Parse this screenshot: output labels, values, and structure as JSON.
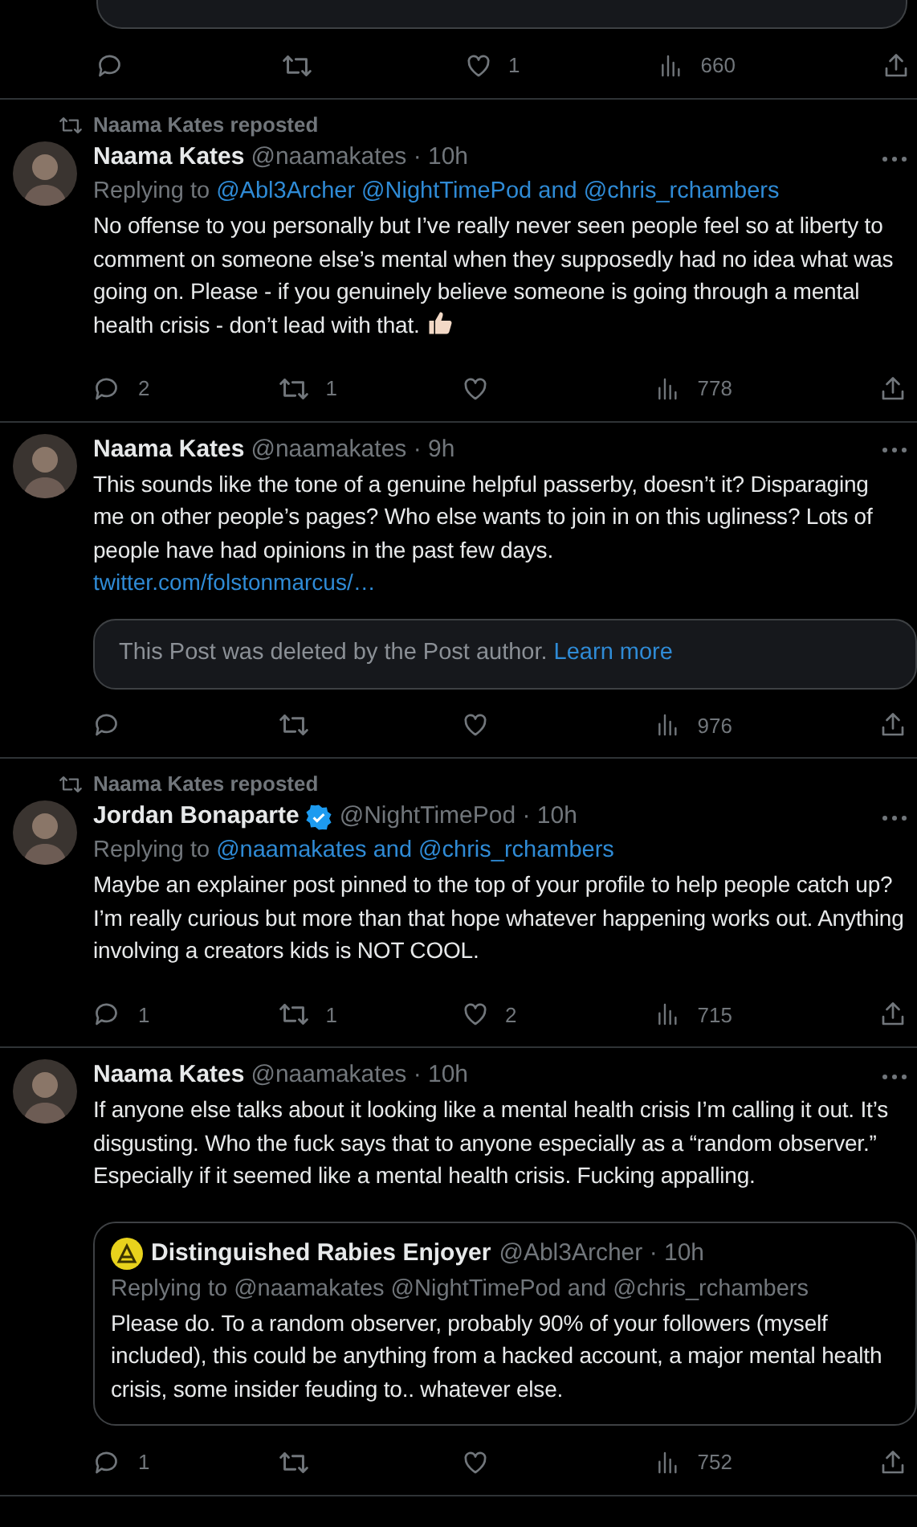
{
  "top_actions": [
    {
      "kind": "reply"
    },
    {
      "kind": "repost"
    },
    {
      "kind": "like",
      "count": "1"
    },
    {
      "kind": "views",
      "count": "660"
    },
    {
      "kind": "share"
    }
  ],
  "posts": [
    {
      "reposted_by": "Naama Kates reposted",
      "name": "Naama Kates",
      "verified": false,
      "meta": "@naamakates · 10h",
      "reply_prefix": "Replying to",
      "reply_to": "@Abl3Archer @NightTimePod and @chris_rchambers",
      "text": "No offense to you personally but I’ve really never seen people feel so at liberty to comment on someone else’s mental when they supposedly had no idea what was going on. Please - if you genuinely believe someone is going through a mental health crisis - don’t lead with that.",
      "ends_with_emoji": true,
      "actions": [
        {
          "kind": "reply",
          "count": "2"
        },
        {
          "kind": "repost",
          "count": "1"
        },
        {
          "kind": "like"
        },
        {
          "kind": "views",
          "count": "778"
        },
        {
          "kind": "share"
        }
      ]
    },
    {
      "name": "Naama Kates",
      "verified": false,
      "meta": "@naamakates · 9h",
      "text": "This sounds like the tone of a genuine helpful passerby, doesn’t it? Disparaging me on other people’s pages? Who else wants to join in on this ugliness? Lots of people have had opinions in the past few days.",
      "link": "twitter.com/folstonmarcus/…",
      "deleted_notice": {
        "text": "This Post was deleted by the Post author.",
        "link": "Learn more"
      },
      "actions": [
        {
          "kind": "reply"
        },
        {
          "kind": "repost"
        },
        {
          "kind": "like"
        },
        {
          "kind": "views",
          "count": "976"
        },
        {
          "kind": "share"
        }
      ]
    },
    {
      "reposted_by": "Naama Kates reposted",
      "name": "Jordan Bonaparte",
      "verified": true,
      "meta": "@NightTimePod · 10h",
      "reply_prefix": "Replying to",
      "reply_to": "@naamakates and @chris_rchambers",
      "text": "Maybe an explainer post pinned to the top of your profile to help people catch up? I’m really curious but more than that hope whatever happening works out. Anything involving a creators kids is NOT COOL.",
      "actions": [
        {
          "kind": "reply",
          "count": "1"
        },
        {
          "kind": "repost",
          "count": "1"
        },
        {
          "kind": "like",
          "count": "2"
        },
        {
          "kind": "views",
          "count": "715"
        },
        {
          "kind": "share"
        }
      ]
    },
    {
      "name": "Naama Kates",
      "verified": false,
      "meta": "@naamakates · 10h",
      "text": "If anyone else talks about it looking like a mental health crisis I’m calling it out. It’s disgusting. Who the fuck says that to anyone especially as a “random observer.” Especially if it seemed like a mental health crisis. Fucking appalling.",
      "quote": {
        "name": "Distinguished Rabies Enjoyer",
        "meta": "@Abl3Archer · 10h",
        "reply_text": "Replying to @naamakates @NightTimePod and @chris_rchambers",
        "text": "Please do. To a random observer, probably 90% of your followers (myself included), this could be anything from a hacked account, a major mental health crisis, some insider feuding to.. whatever else."
      },
      "actions": [
        {
          "kind": "reply",
          "count": "1"
        },
        {
          "kind": "repost"
        },
        {
          "kind": "like"
        },
        {
          "kind": "views",
          "count": "752"
        },
        {
          "kind": "share"
        }
      ]
    }
  ]
}
